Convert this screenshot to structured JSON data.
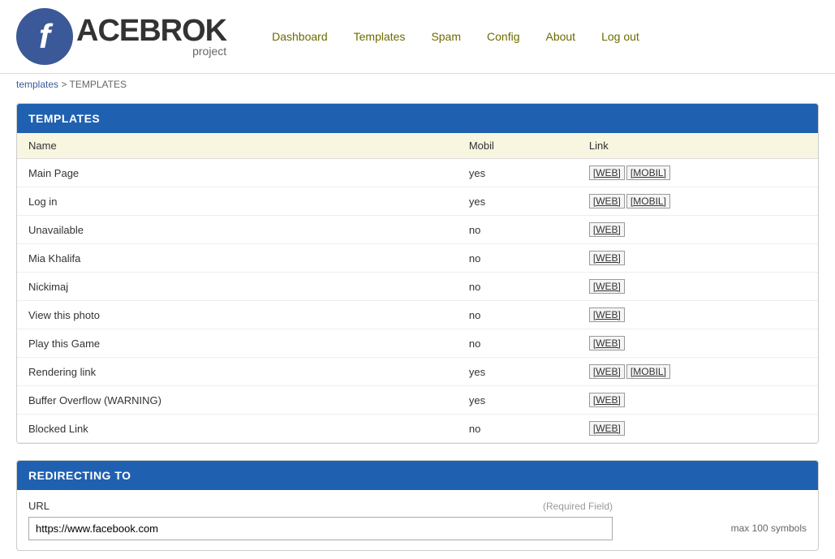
{
  "logo": {
    "letter": "f",
    "name": "ACEBROK",
    "project": "project"
  },
  "nav": {
    "items": [
      {
        "label": "Dashboard",
        "href": "#"
      },
      {
        "label": "Templates",
        "href": "#"
      },
      {
        "label": "Spam",
        "href": "#"
      },
      {
        "label": "Config",
        "href": "#"
      },
      {
        "label": "About",
        "href": "#"
      },
      {
        "label": "Log out",
        "href": "#"
      }
    ]
  },
  "breadcrumb": {
    "link_text": "templates",
    "separator": ">",
    "current": "TEMPLATES"
  },
  "templates_table": {
    "header": "TEMPLATES",
    "columns": [
      "Name",
      "Mobil",
      "Link"
    ],
    "rows": [
      {
        "name": "Main Page",
        "mobil": "yes",
        "links": [
          "[WEB]",
          "[MOBIL]"
        ]
      },
      {
        "name": "Log in",
        "mobil": "yes",
        "links": [
          "[WEB]",
          "[MOBIL]"
        ]
      },
      {
        "name": "Unavailable",
        "mobil": "no",
        "links": [
          "[WEB]"
        ]
      },
      {
        "name": "Mia Khalifa",
        "mobil": "no",
        "links": [
          "[WEB]"
        ]
      },
      {
        "name": "Nickimaj",
        "mobil": "no",
        "links": [
          "[WEB]"
        ]
      },
      {
        "name": "View this photo",
        "mobil": "no",
        "links": [
          "[WEB]"
        ]
      },
      {
        "name": "Play this Game",
        "mobil": "no",
        "links": [
          "[WEB]"
        ]
      },
      {
        "name": "Rendering link",
        "mobil": "yes",
        "links": [
          "[WEB]",
          "[MOBIL]"
        ]
      },
      {
        "name": "Buffer Overflow (WARNING)",
        "mobil": "yes",
        "links": [
          "[WEB]"
        ]
      },
      {
        "name": "Blocked Link",
        "mobil": "no",
        "links": [
          "[WEB]"
        ]
      }
    ]
  },
  "redirect_section": {
    "header": "REDIRECTING TO",
    "url_label": "URL",
    "required_text": "(Required Field)",
    "max_text": "max 100 symbols",
    "url_value": "https://www.facebook.com"
  }
}
